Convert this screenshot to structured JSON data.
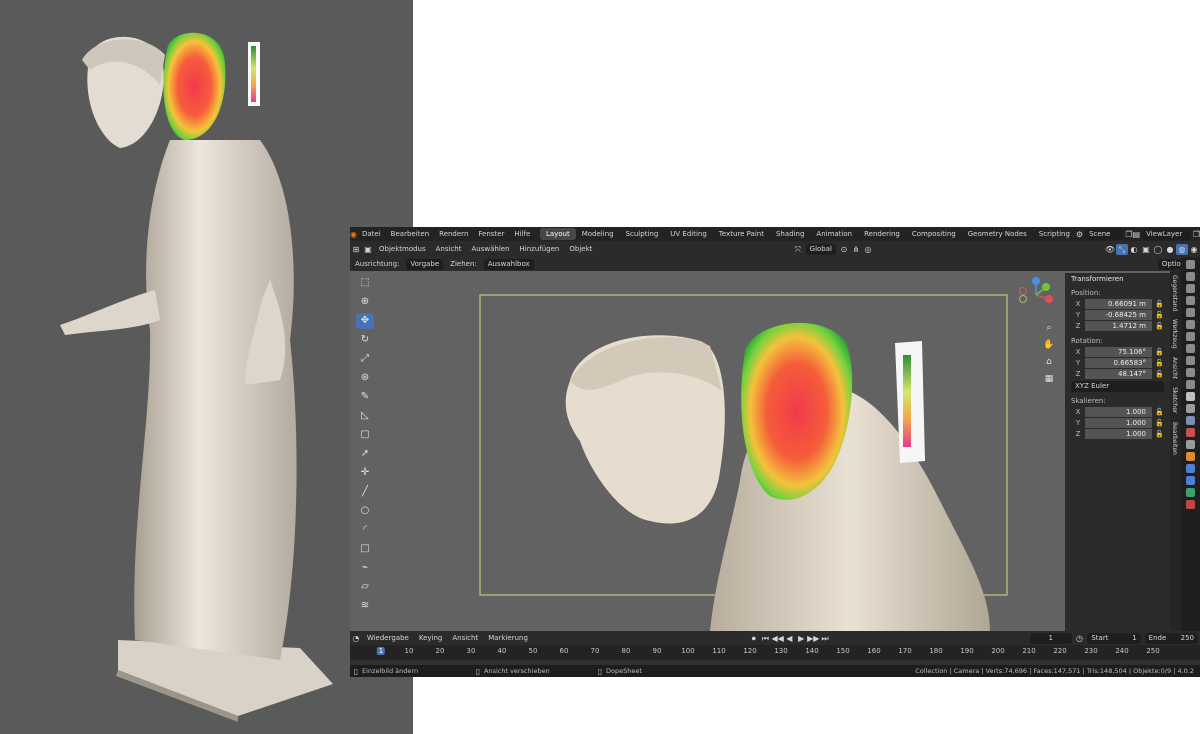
{
  "topbar": {
    "menus": [
      "Datei",
      "Bearbeiten",
      "Rendern",
      "Fenster",
      "Hilfe"
    ],
    "workspaces": [
      "Layout",
      "Modeling",
      "Sculpting",
      "UV Editing",
      "Texture Paint",
      "Shading",
      "Animation",
      "Rendering",
      "Compositing",
      "Geometry Nodes",
      "Scripting"
    ],
    "active_workspace": "Layout",
    "scene": "Scene",
    "view_layer": "ViewLayer"
  },
  "header": {
    "mode": "Objektmodus",
    "menus": [
      "Ansicht",
      "Auswählen",
      "Hinzufügen",
      "Objekt"
    ],
    "orientation": "Global"
  },
  "tool_settings": {
    "orientation_label": "Ausrichtung:",
    "orientation_value": "Vorgabe",
    "drag_label": "Ziehen:",
    "drag_value": "Auswahlbox",
    "options": "Optionen"
  },
  "npanel": {
    "title": "Transformieren",
    "position_label": "Position:",
    "position": [
      "0.66091 m",
      "-0.68425 m",
      "1.4712 m"
    ],
    "rotation_label": "Rotation:",
    "rotation": [
      "75.106°",
      "0.66583°",
      "48.147°"
    ],
    "rotation_mode": "XYZ Euler",
    "scale_label": "Skalieren:",
    "scale": [
      "1.000",
      "1.000",
      "1.000"
    ],
    "axes": [
      "X",
      "Y",
      "Z"
    ],
    "tabs": [
      "Gegenstand",
      "Werkzeug",
      "Ansicht",
      "Sketcher",
      "Bearbeiten"
    ]
  },
  "timeline": {
    "menus": [
      "Wiedergabe",
      "Keying",
      "Ansicht",
      "Markierung"
    ],
    "current_frame": "1",
    "start_label": "Start",
    "start": "1",
    "end_label": "Ende",
    "end": "250",
    "ticks": [
      "1",
      "10",
      "20",
      "30",
      "40",
      "50",
      "60",
      "70",
      "80",
      "90",
      "100",
      "110",
      "120",
      "130",
      "140",
      "150",
      "160",
      "170",
      "180",
      "190",
      "200",
      "210",
      "220",
      "230",
      "240",
      "250"
    ]
  },
  "statusbar": {
    "hint1": "Einzelbild ändern",
    "hint2": "Ansicht verschieben",
    "hint3": "DopeSheet",
    "stats": "Collection | Camera | Verts:74,696 | Faces:147,571 | Tris:148,504 | Objekte:0/9 | 4.0.2"
  },
  "colors": {
    "accent": "#4772b3",
    "viewport_bg": "#626262",
    "camera_frame": "#d9d98a",
    "left_bg": "#5a5a5a"
  }
}
